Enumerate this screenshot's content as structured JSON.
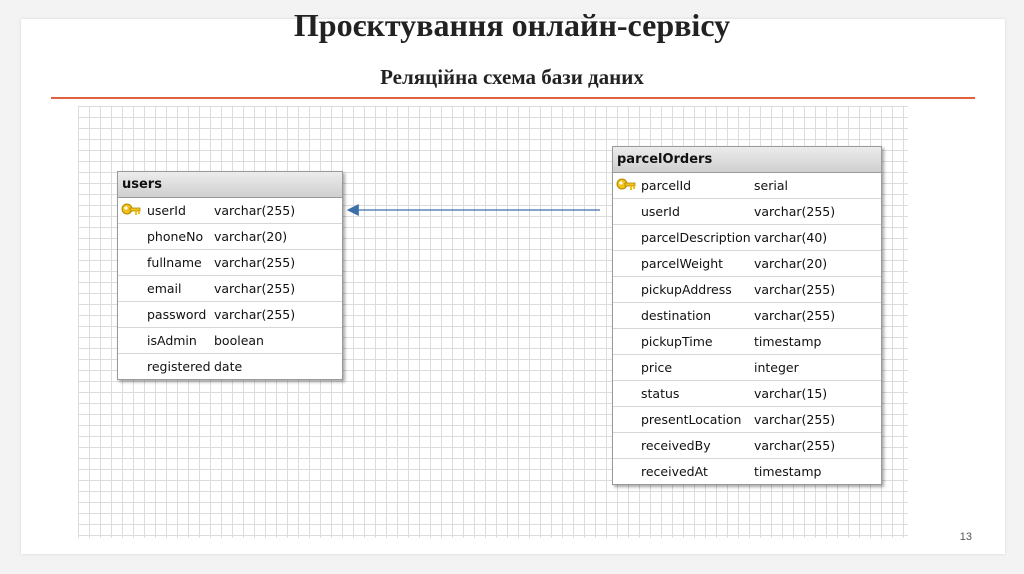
{
  "slide": {
    "title": "Проєктування онлайн-сервісу",
    "subtitle": "Реляційна схема бази даних",
    "page_number": "13"
  },
  "tables": {
    "users": {
      "name": "users",
      "columns": [
        {
          "name": "userId",
          "type": "varchar(255)",
          "key": true
        },
        {
          "name": "phoneNo",
          "type": "varchar(20)"
        },
        {
          "name": "fullname",
          "type": "varchar(255)"
        },
        {
          "name": "email",
          "type": "varchar(255)"
        },
        {
          "name": "password",
          "type": "varchar(255)"
        },
        {
          "name": "isAdmin",
          "type": "boolean"
        },
        {
          "name": "registered",
          "type": "date"
        }
      ]
    },
    "parcelOrders": {
      "name": "parcelOrders",
      "columns": [
        {
          "name": "parcelId",
          "type": "serial",
          "key": true
        },
        {
          "name": "userId",
          "type": "varchar(255)"
        },
        {
          "name": "parcelDescription",
          "type": "varchar(40)"
        },
        {
          "name": "parcelWeight",
          "type": "varchar(20)"
        },
        {
          "name": "pickupAddress",
          "type": "varchar(255)"
        },
        {
          "name": "destination",
          "type": "varchar(255)"
        },
        {
          "name": "pickupTime",
          "type": "timestamp"
        },
        {
          "name": "price",
          "type": "integer"
        },
        {
          "name": "status",
          "type": "varchar(15)"
        },
        {
          "name": "presentLocation",
          "type": "varchar(255)"
        },
        {
          "name": "receivedBy",
          "type": "varchar(255)"
        },
        {
          "name": "receivedAt",
          "type": "timestamp"
        }
      ]
    }
  },
  "relation": {
    "from": "parcelOrders.userId",
    "to": "users.userId"
  },
  "colors": {
    "accent_rule": "#e06040",
    "arrow": "#3a6fa8",
    "key_icon": "#f2c21b"
  }
}
